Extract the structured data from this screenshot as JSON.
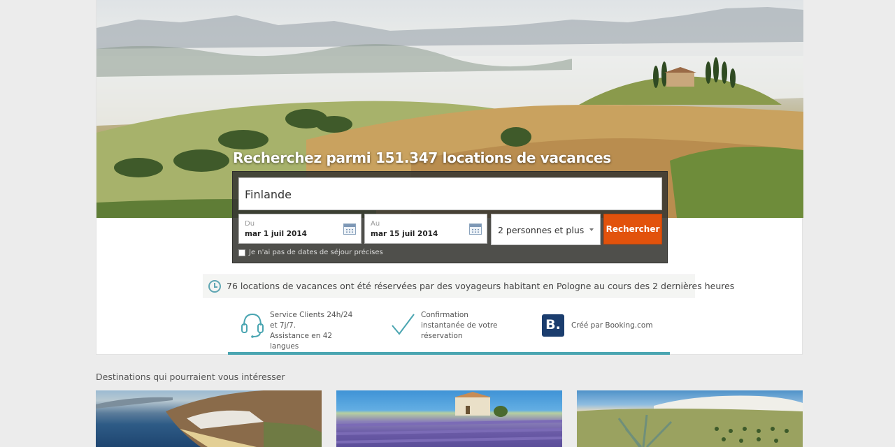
{
  "hero": {
    "headline": "Recherchez parmi 151.347 locations de vacances"
  },
  "search": {
    "destination_value": "Finlande",
    "checkin_label": "Du",
    "checkin_value": "mar 1 juil 2014",
    "checkout_label": "Au",
    "checkout_value": "mar 15 juil 2014",
    "guests_value": "2 personnes et plus",
    "search_button_label": "Rechercher",
    "flexible_dates_label": "Je n'ai pas de dates de séjour précises"
  },
  "recent_bookings": {
    "text": "76 locations de vacances ont été réservées par des voyageurs habitant en Pologne au cours des 2 dernières heures"
  },
  "features": [
    {
      "icon": "headset-icon",
      "line1": "Service Clients 24h/24 et 7j/7.",
      "line2": "Assistance en 42 langues"
    },
    {
      "icon": "checkmark-icon",
      "line1": "Confirmation instantanée de votre réservation"
    },
    {
      "icon": "booking-logo-icon",
      "logo_letter": "B.",
      "line1": "Créé par Booking.com"
    }
  ],
  "destinations": {
    "heading": "Destinations qui pourraient vous intéresser"
  },
  "colors": {
    "accent_orange": "#e2520c",
    "accent_teal": "#4aa5b1",
    "booking_blue": "#1b3d6e"
  }
}
